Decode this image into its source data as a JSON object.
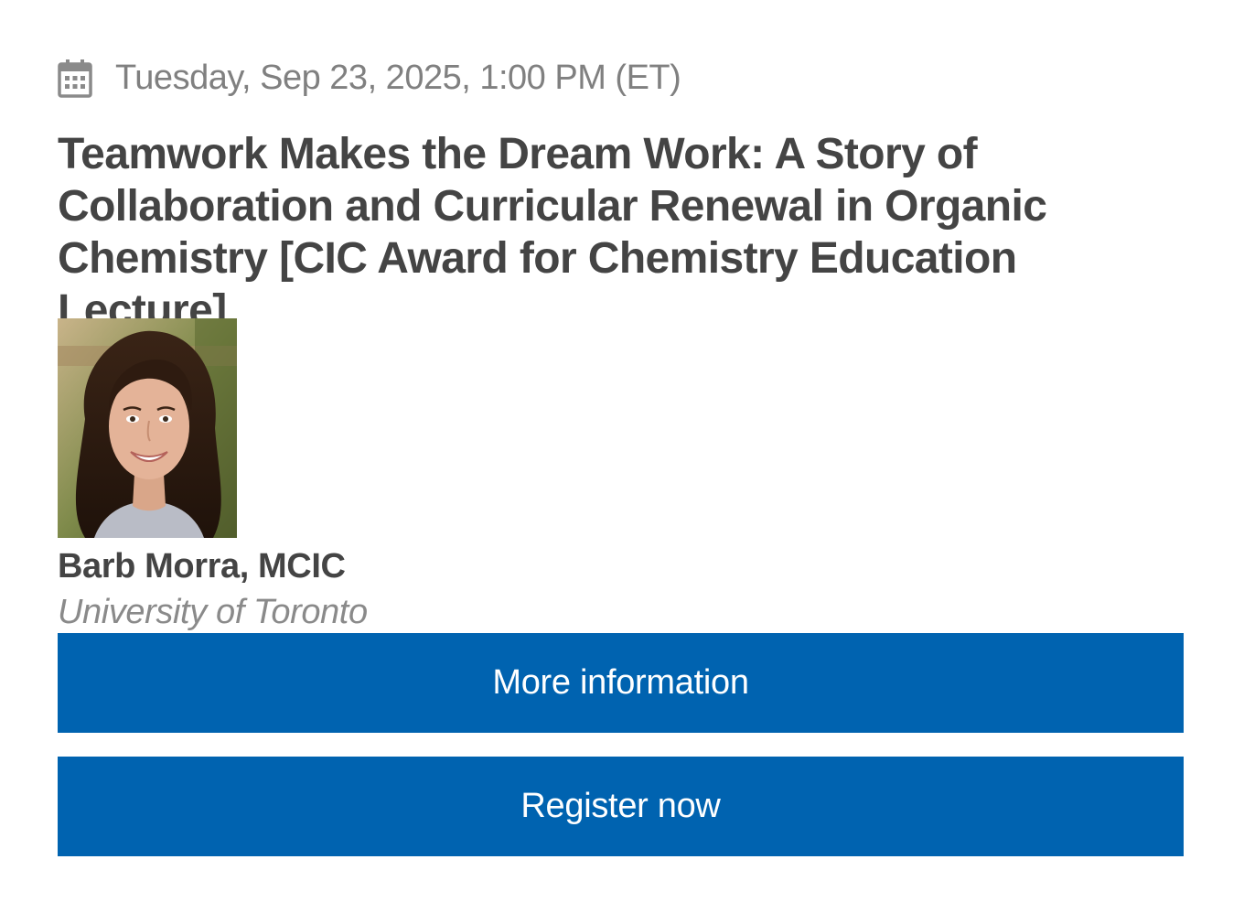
{
  "event": {
    "date_icon": "calendar-icon",
    "datetime": "Tuesday, Sep 23, 2025, 1:00 PM (ET)",
    "title": "Teamwork Makes the Dream Work: A Story of Collaboration and Curricular Renewal in Organic Chemistry [CIC Award for Chemistry Education Lecture]"
  },
  "speaker": {
    "name": "Barb Morra, MCIC",
    "affiliation": "University of Toronto"
  },
  "buttons": {
    "more_info_label": "More information",
    "register_label": "Register now"
  },
  "colors": {
    "button_bg": "#0063b0",
    "button_text": "#ffffff",
    "title_text": "#444444",
    "muted_text": "#808080"
  }
}
